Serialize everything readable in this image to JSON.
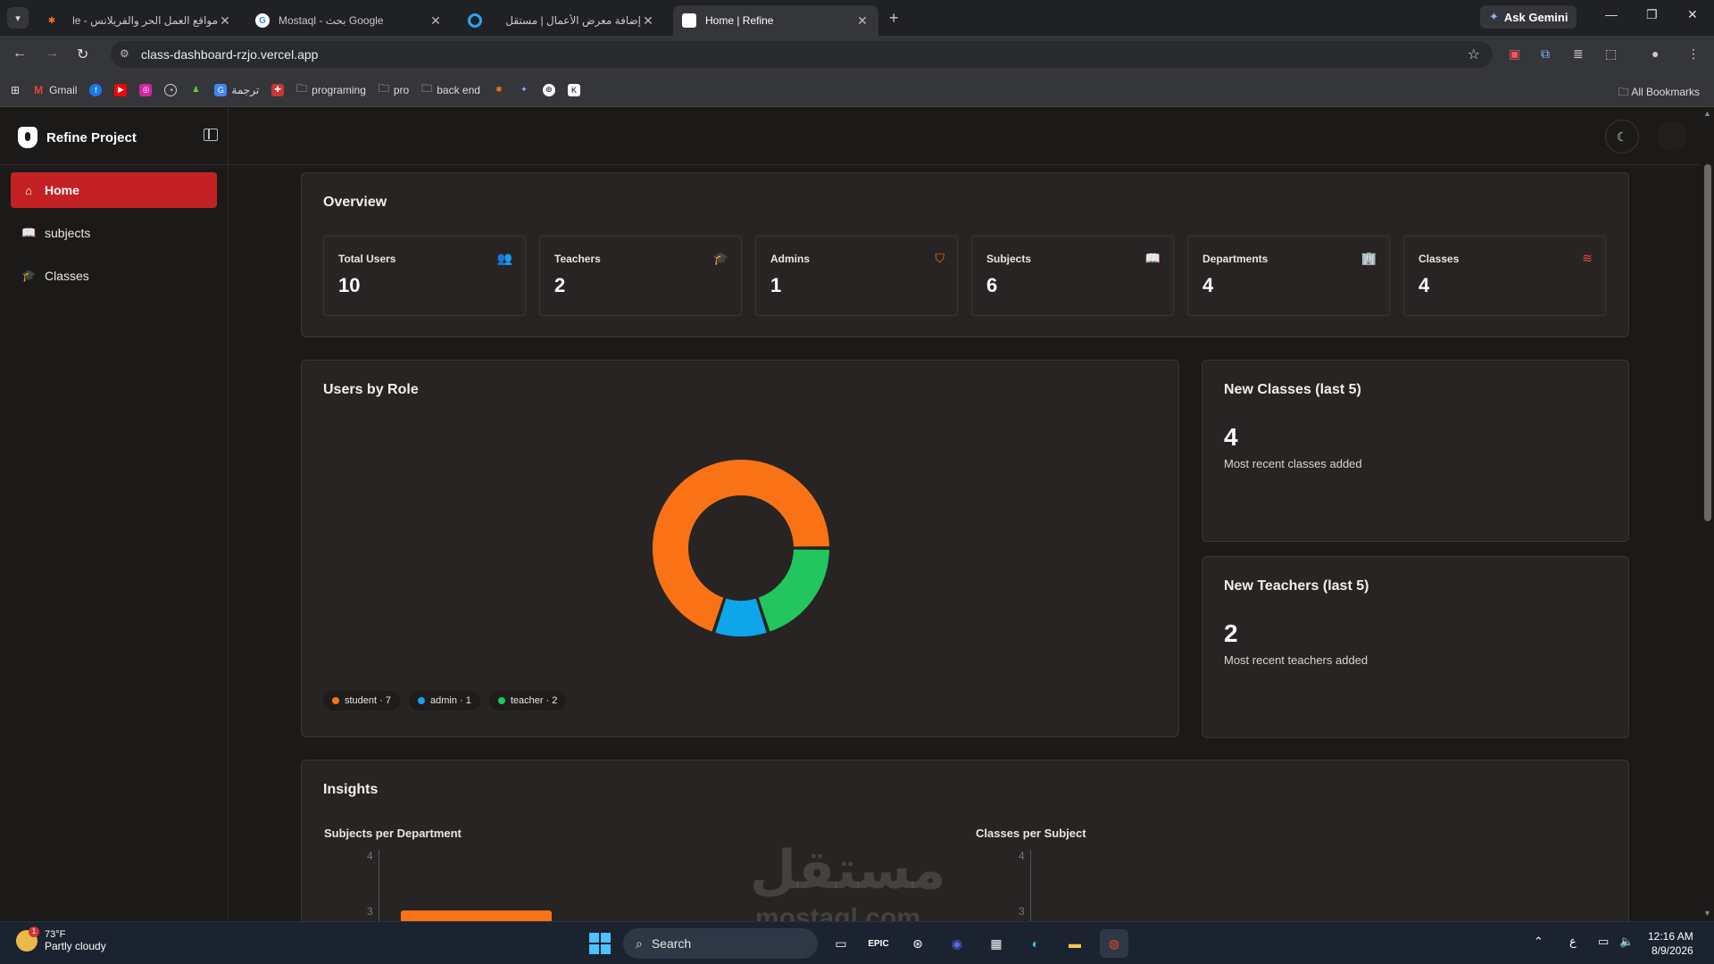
{
  "browser": {
    "tabs": [
      {
        "title": "مواقع العمل الحر والفريلانس - le"
      },
      {
        "title": "Mostaql - بحث Google"
      },
      {
        "title": "إضافة معرض الأعمال | مستقل"
      },
      {
        "title": "Home | Refine"
      }
    ],
    "new_tab": "+",
    "ask_gemini": "Ask Gemini",
    "url": "class-dashboard-rzjo.vercel.app",
    "bookmarks": [
      "Gmail",
      "ترجمة",
      "programing",
      "pro",
      "back end"
    ],
    "all_bookmarks": "All Bookmarks"
  },
  "app": {
    "brand": "Refine Project",
    "nav": [
      {
        "label": "Home",
        "icon": "home-icon",
        "active": true
      },
      {
        "label": "subjects",
        "icon": "book-icon",
        "active": false
      },
      {
        "label": "Classes",
        "icon": "graduation-cap-icon",
        "active": false
      }
    ]
  },
  "overview": {
    "title": "Overview",
    "stats": [
      {
        "label": "Total Users",
        "value": "10",
        "icon": "users-icon",
        "color": "#3b82f6"
      },
      {
        "label": "Teachers",
        "value": "2",
        "icon": "graduation-cap-icon",
        "color": "#22c55e"
      },
      {
        "label": "Admins",
        "value": "1",
        "icon": "shield-icon",
        "color": "#f97316"
      },
      {
        "label": "Subjects",
        "value": "6",
        "icon": "book-open-icon",
        "color": "#a855f7"
      },
      {
        "label": "Departments",
        "value": "4",
        "icon": "building-icon",
        "color": "#3b82f6"
      },
      {
        "label": "Classes",
        "value": "4",
        "icon": "layers-icon",
        "color": "#ef4444"
      }
    ]
  },
  "users_by_role": {
    "title": "Users by Role",
    "legend": [
      "student · 7",
      "admin · 1",
      "teacher · 2"
    ]
  },
  "chart_data": {
    "type": "pie",
    "categories": [
      "student",
      "admin",
      "teacher"
    ],
    "values": [
      7,
      1,
      2
    ],
    "colors": [
      "#f97316",
      "#0ea5e9",
      "#22c55e"
    ],
    "style": "donut",
    "legend": "bottom-left"
  },
  "new_classes": {
    "title": "New Classes (last 5)",
    "count": "4",
    "subtitle": "Most recent classes added"
  },
  "new_teachers": {
    "title": "New Teachers (last 5)",
    "count": "2",
    "subtitle": "Most recent teachers added"
  },
  "insights": {
    "title": "Insights",
    "subjects_per_department": {
      "title": "Subjects per Department",
      "ticks": [
        "4",
        "3"
      ]
    },
    "classes_per_subject": {
      "title": "Classes per Subject",
      "ticks": [
        "4",
        "3"
      ]
    }
  },
  "watermark": {
    "text": "مستقل",
    "sub": "mostaql.com"
  },
  "taskbar": {
    "temperature": "73°F",
    "weather": "Partly cloudy",
    "weather_badge": "1",
    "search": "Search",
    "time": "12:16 AM",
    "date": "8/9/2026",
    "lang": "ع"
  }
}
